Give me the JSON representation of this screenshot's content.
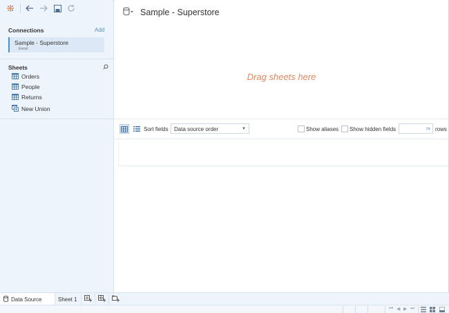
{
  "connections": {
    "heading": "Connections",
    "add_label": "Add",
    "items": [
      {
        "name": "Sample - Superstore",
        "type": "Excel"
      }
    ]
  },
  "sheets": {
    "heading": "Sheets",
    "items": [
      {
        "label": "Orders",
        "icon": "table-icon"
      },
      {
        "label": "People",
        "icon": "table-icon"
      },
      {
        "label": "Returns",
        "icon": "table-icon"
      },
      {
        "label": "New Union",
        "icon": "union-icon"
      }
    ]
  },
  "main": {
    "title": "Sample - Superstore",
    "drop_hint": "Drag sheets here"
  },
  "grid_toolbar": {
    "sort_label": "Sort fields",
    "sort_value": "Data source order",
    "show_aliases": "Show aliases",
    "show_hidden": "Show hidden fields",
    "rows_label": "rows",
    "rows_value": ""
  },
  "tabs": {
    "data_source": "Data Source",
    "sheet1": "Sheet 1"
  },
  "colors": {
    "accent": "#4a90c8",
    "drop_hint": "#e9855b",
    "sidebar_bg": "#eef4fb"
  }
}
